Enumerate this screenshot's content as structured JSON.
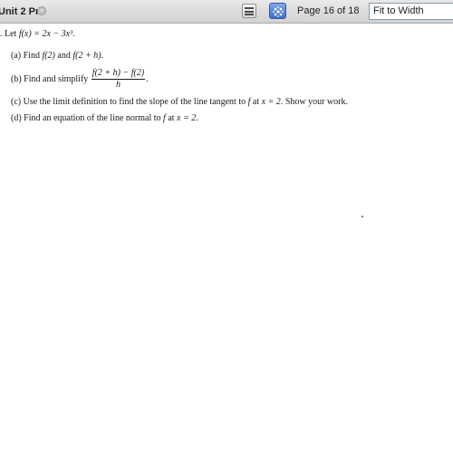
{
  "window": {
    "tab_title": "Unit 2 Pr*",
    "close_glyph": "×",
    "page_indicator": "Page 16 of 18",
    "zoom_value": "Fit to Width",
    "sidebar_icon": "sidebar-toggle-icon",
    "tool_icon": "select-tool-icon"
  },
  "problem": {
    "intro_prefix": ". Let ",
    "intro_math": "f(x) = 2x − 3x³",
    "intro_suffix": ".",
    "a": {
      "marker": "(a)",
      "text_pre": "Find ",
      "math1": "f(2)",
      "text_mid": " and ",
      "math2": "f(2 + h)",
      "text_post": "."
    },
    "b": {
      "marker": "(b)",
      "text_pre": "Find and simplify ",
      "numerator": "f(2 + h) − f(2)",
      "denominator": "h",
      "text_post": "."
    },
    "c": {
      "marker": "(c)",
      "text_pre": "Use the limit definition to find the slope of the line tangent to ",
      "math1": "f",
      "text_mid": " at ",
      "math2": "x = 2",
      "text_post": ". Show your work."
    },
    "d": {
      "marker": "(d)",
      "text_pre": "Find an equation of the line normal to ",
      "math1": "f",
      "text_mid": " at ",
      "math2": "x = 2",
      "text_post": "."
    }
  }
}
